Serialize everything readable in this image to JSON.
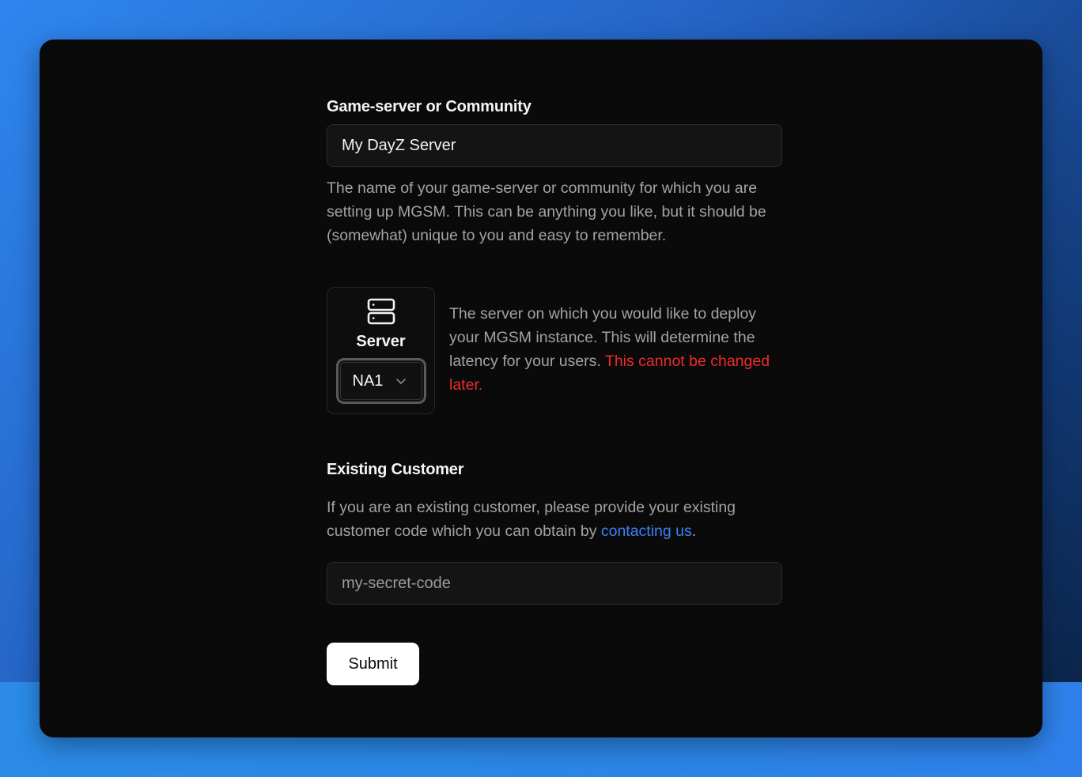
{
  "form": {
    "name_label": "Game-server or Community",
    "name_value": "My DayZ Server",
    "name_help": "The name of your game-server or community for which you are setting up MGSM. This can be anything you like, but it should be (somewhat) unique to you and easy to remember.",
    "server": {
      "icon": "server-icon",
      "label": "Server",
      "selected": "NA1",
      "help_text": "The server on which you would like to deploy your MGSM instance. This will determine the latency for your users. ",
      "warning_text": "This cannot be changed later."
    },
    "customer": {
      "title": "Existing Customer",
      "help_before": "If you are an existing customer, please provide your existing customer code which you can obtain by ",
      "link_text": "contacting us",
      "help_after": ".",
      "placeholder": "my-secret-code"
    },
    "submit_label": "Submit"
  },
  "colors": {
    "background": "#0a0a0a",
    "warning": "#ef2b2b",
    "link": "#3b82f6",
    "button_bg": "#ffffff"
  }
}
